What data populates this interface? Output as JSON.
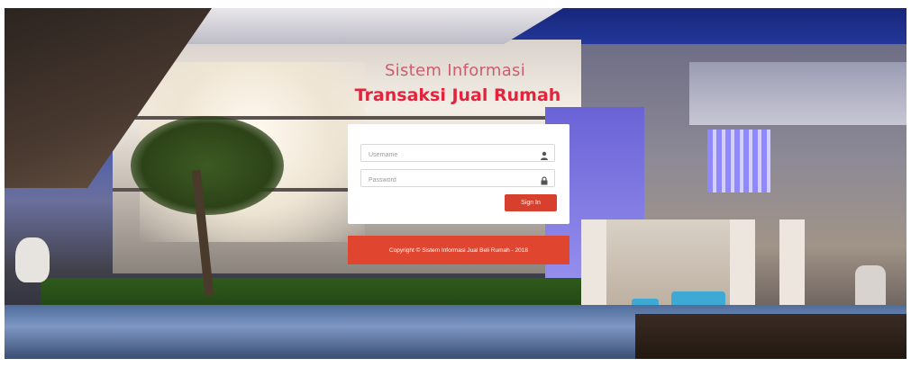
{
  "header": {
    "title_line1": "Sistem Informasi",
    "title_line2": "Transaksi Jual Rumah"
  },
  "login": {
    "username_placeholder": "Username",
    "password_placeholder": "Password",
    "username_icon": "user-icon",
    "password_icon": "lock-icon",
    "signin_label": "Sign In"
  },
  "footer": {
    "copyright": "Copyright © Sistem Informasi Jual Beli Rumah - 2018"
  },
  "colors": {
    "accent": "#d8402e",
    "title": "#e3243c"
  }
}
